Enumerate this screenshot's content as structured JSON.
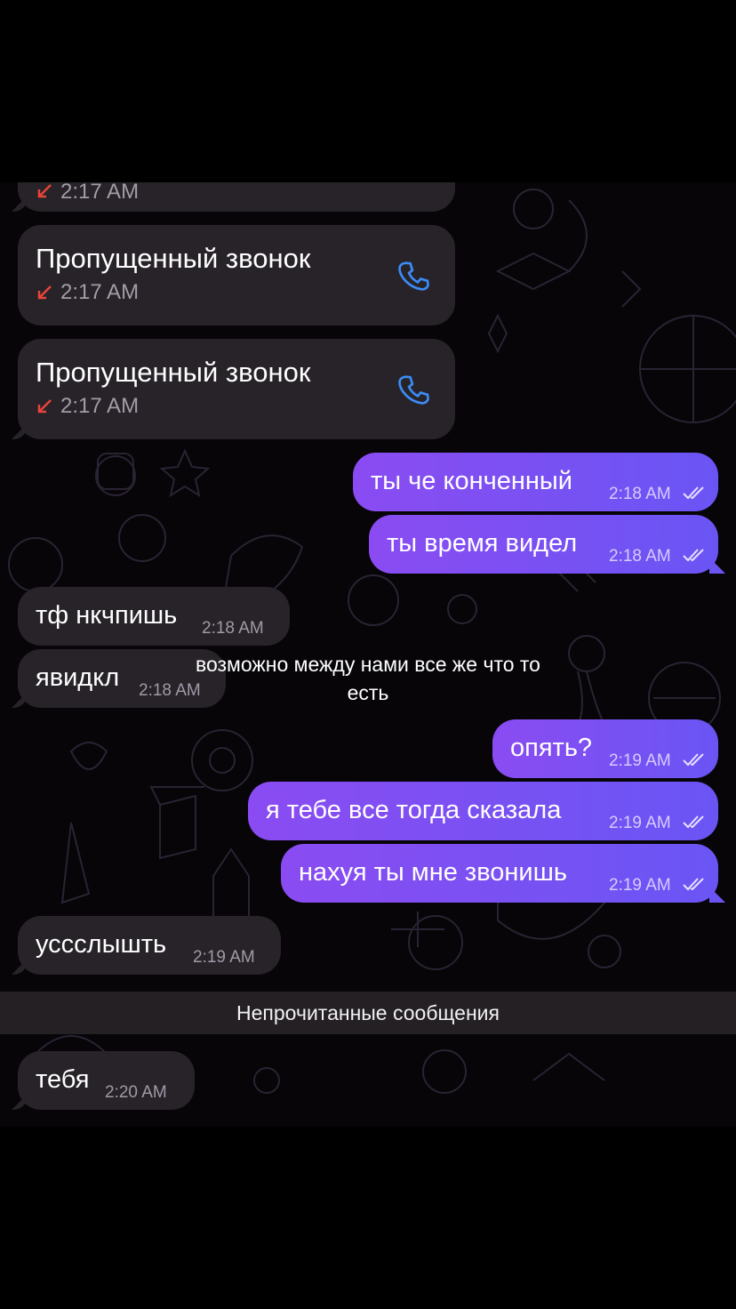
{
  "overlay_caption": "возможно между нами все же что то есть",
  "partial_message": {
    "time": "2:17 AM"
  },
  "calls": [
    {
      "title": "Пропущенный звонок",
      "time": "2:17 AM",
      "arrow_icon": "missed-call-arrow-icon",
      "call_icon": "phone-icon"
    },
    {
      "title": "Пропущенный звонок",
      "time": "2:17 AM",
      "arrow_icon": "missed-call-arrow-icon",
      "call_icon": "phone-icon"
    }
  ],
  "messages": [
    {
      "text": "ты че конченный",
      "time": "2:18 AM",
      "direction": "out",
      "read": true
    },
    {
      "text": "ты время видел",
      "time": "2:18 AM",
      "direction": "out",
      "read": true
    },
    {
      "text": "тф нкчпишь",
      "time": "2:18 AM",
      "direction": "in"
    },
    {
      "text": "явидкл",
      "time": "2:18 AM",
      "direction": "in"
    },
    {
      "text": "опять?",
      "time": "2:19 AM",
      "direction": "out",
      "read": true
    },
    {
      "text": "я тебе все тогда сказала",
      "time": "2:19 AM",
      "direction": "out",
      "read": true
    },
    {
      "text": "нахуя ты мне звонишь",
      "time": "2:19 AM",
      "direction": "out",
      "read": true
    },
    {
      "text": "уссслышть",
      "time": "2:19 AM",
      "direction": "in"
    },
    {
      "text": "тебя",
      "time": "2:20 AM",
      "direction": "in"
    }
  ],
  "unread_divider": "Непрочитанные сообщения",
  "colors": {
    "incoming_bubble": "#272329",
    "outgoing_gradient_start": "#8a4cf2",
    "outgoing_gradient_end": "#6a55f4",
    "missed_call_red": "#e8443a",
    "phone_icon_blue": "#3b8cf5",
    "background": "#070508"
  }
}
